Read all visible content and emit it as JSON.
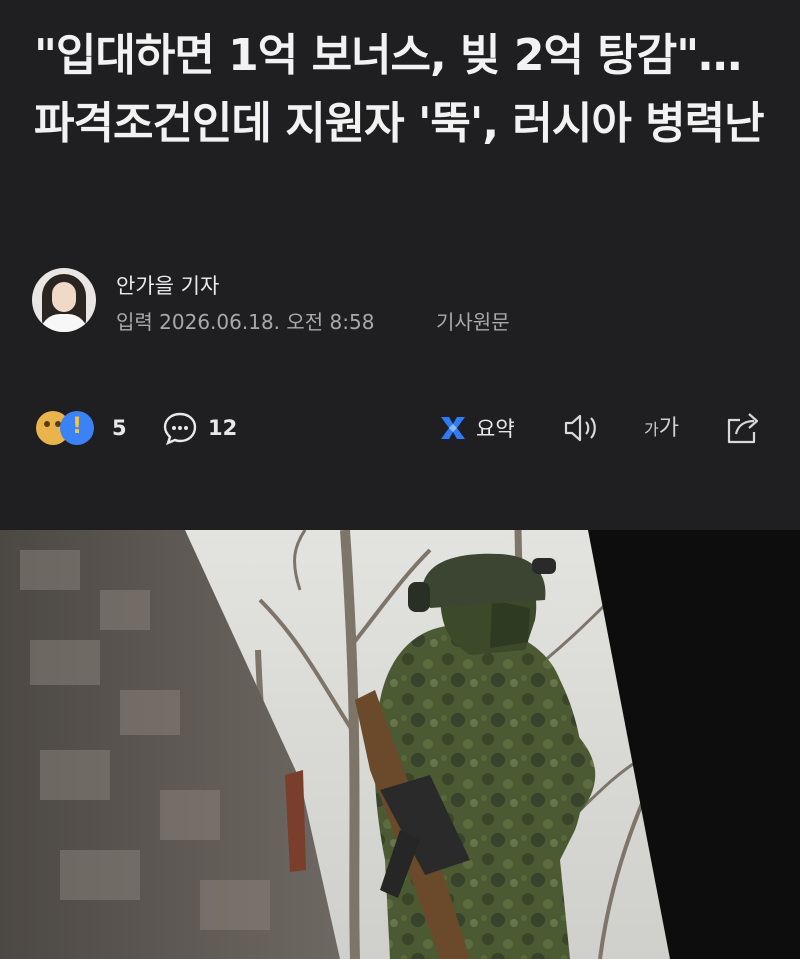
{
  "article": {
    "headline": "\"입대하면 1억 보너스, 빚 2억 탕감\"…파격조건인데 지원자 '뚝', 러시아 병력난"
  },
  "author": {
    "name": "안가을 기자",
    "date_line": "입력 2026.06.18. 오전 8:58",
    "original_link": "기사원문"
  },
  "toolbar": {
    "reaction_count": "5",
    "comment_count": "12",
    "summary_label": "요약",
    "font_small": "가",
    "font_big": "가"
  },
  "icons": {
    "reaction": "reaction-emoji-icon",
    "comment": "speech-bubble-icon",
    "summary": "ai-summary-icon",
    "tts": "speaker-icon",
    "share": "share-icon"
  },
  "colors": {
    "background": "#1f1f21",
    "summary_accent": "#2f7bf6"
  }
}
